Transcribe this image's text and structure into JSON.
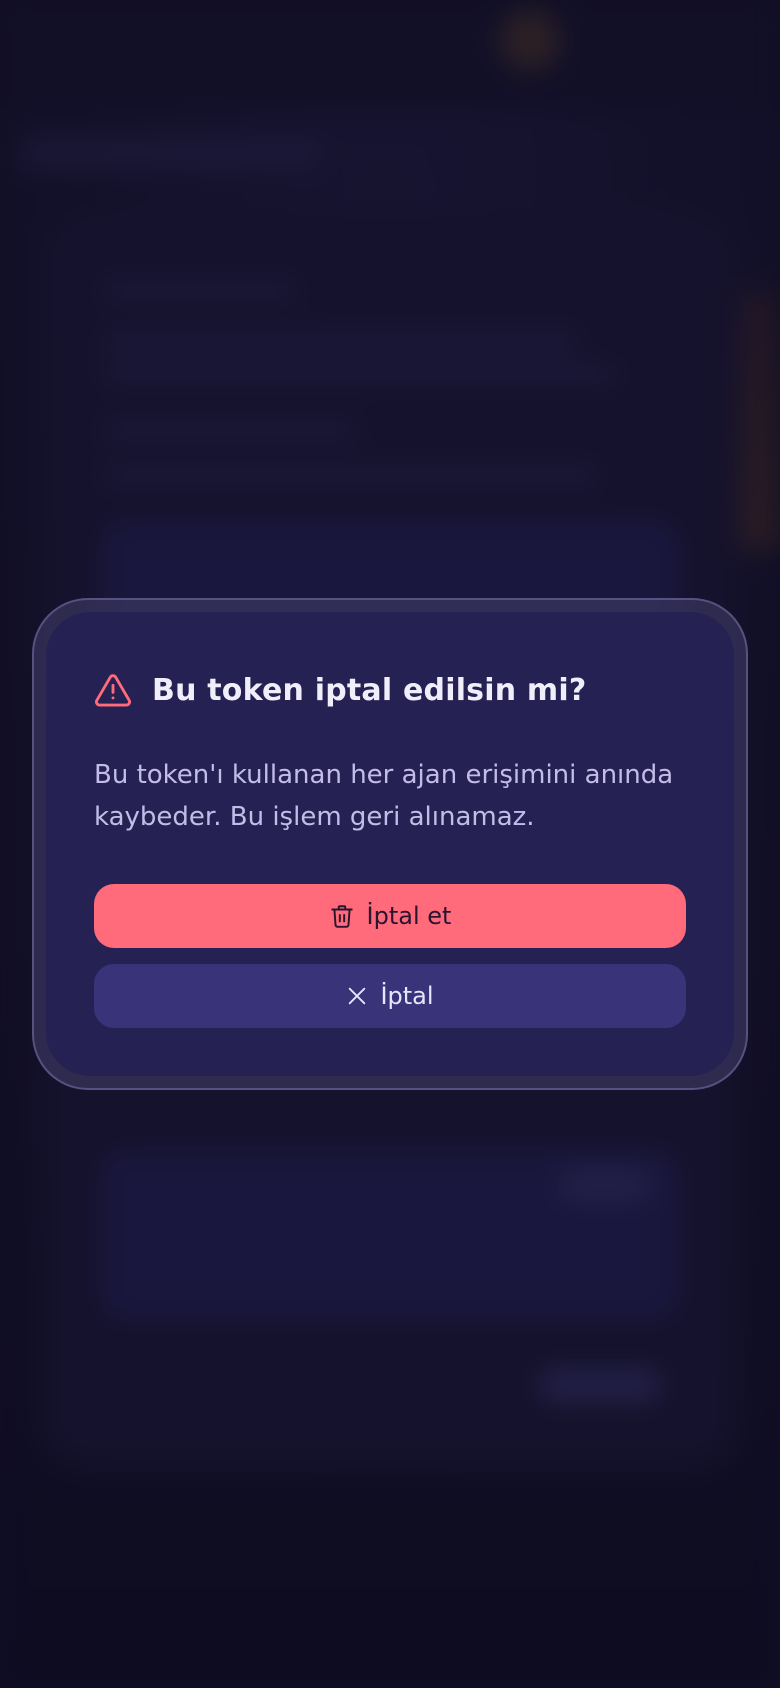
{
  "dialog": {
    "icon": "warning-triangle-icon",
    "title": "Bu token iptal edilsin mi?",
    "message": "Bu token'ı kullanan her ajan erişimini anında kaybeder. Bu işlem geri alınamaz.",
    "confirm_button": {
      "label": "İptal et",
      "icon": "trash-icon"
    },
    "cancel_button": {
      "label": "İptal",
      "icon": "close-icon"
    }
  },
  "colors": {
    "page_background": "#16122b",
    "dialog_background": "#262153",
    "danger": "#ff6b7a",
    "secondary_button": "#39337a",
    "title_text": "#f1eefc",
    "message_text": "#c2bce6"
  }
}
